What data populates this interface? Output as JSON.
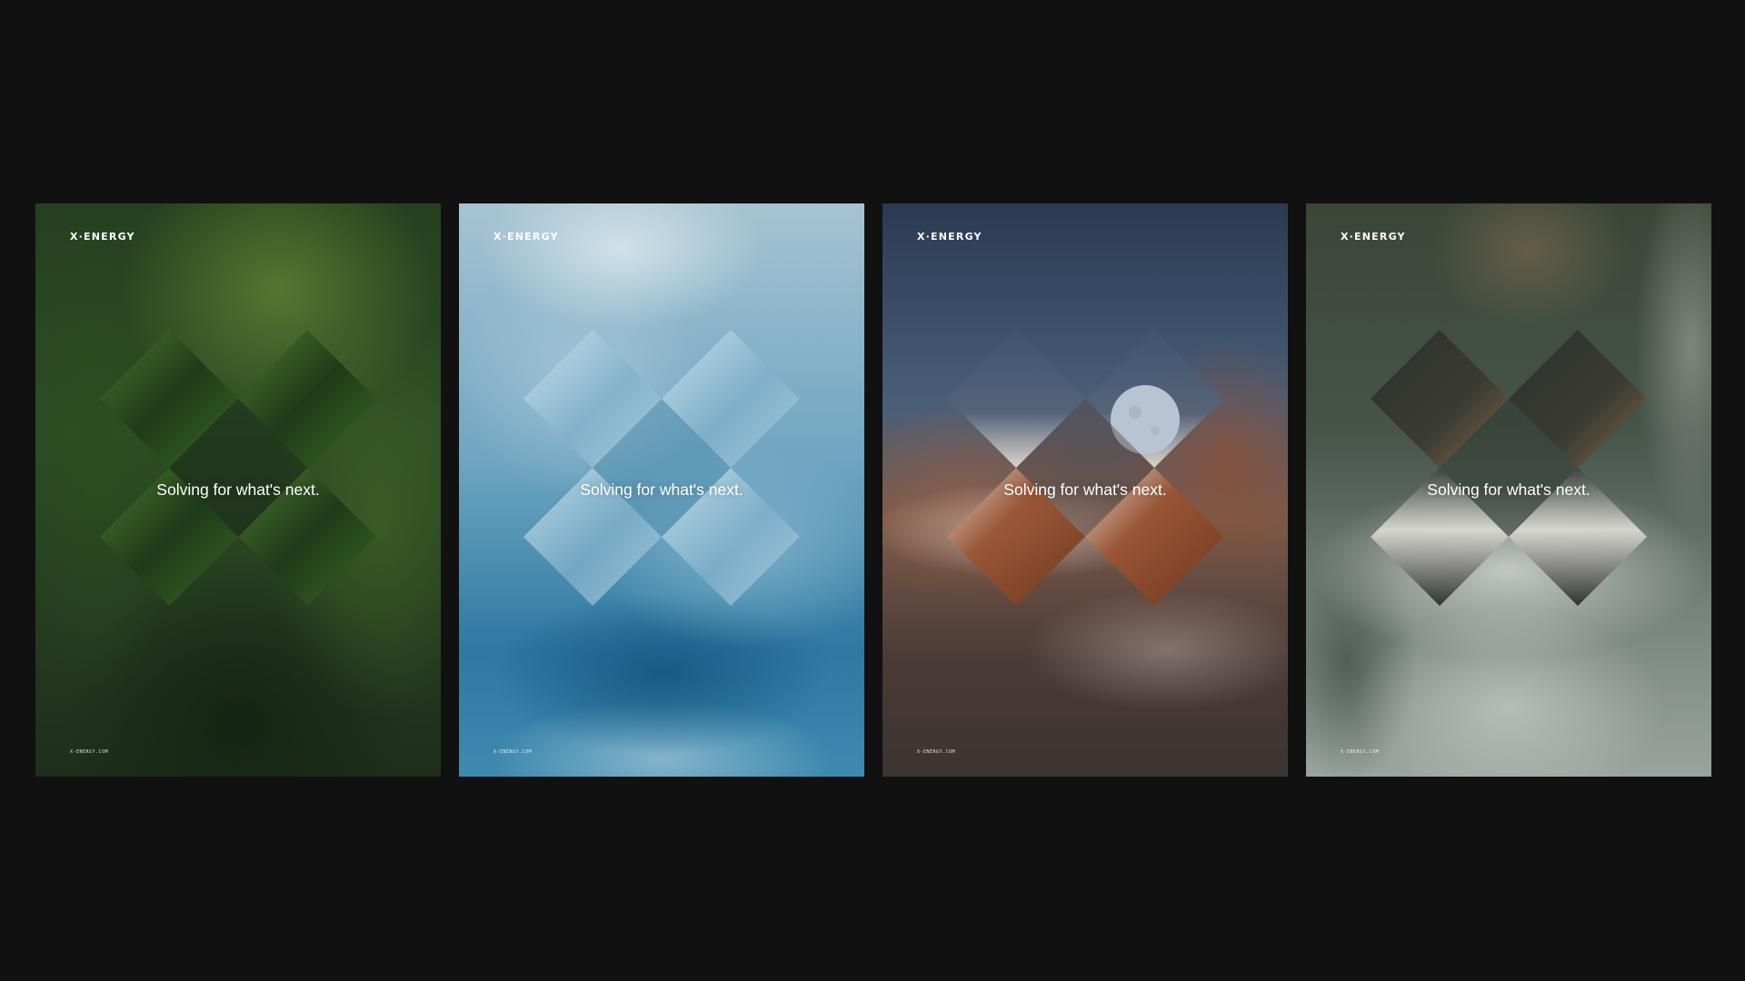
{
  "posters": [
    {
      "logo": "X·ENERGY",
      "tagline": "Solving for what's next.",
      "url": "X-ENERGY.COM",
      "theme": "forest",
      "colors": {
        "bg_top": "#1f3a1d",
        "bg_mid": "#2f5326",
        "bg_bottom": "#1b2818",
        "diamond": "#22401a",
        "diamond_highlight": "#4e7a2e"
      }
    },
    {
      "logo": "X·ENERGY",
      "tagline": "Solving for what's next.",
      "url": "X-ENERGY.COM",
      "theme": "clouds",
      "colors": {
        "bg_top": "#9fc0d2",
        "bg_mid": "#5f9ab8",
        "bg_bottom": "#1f5f85",
        "diamond": "#8fbcd3",
        "diamond_highlight": "#d8ebf3"
      }
    },
    {
      "logo": "X·ENERGY",
      "tagline": "Solving for what's next.",
      "url": "X-ENERGY.COM",
      "theme": "mountain-moon",
      "colors": {
        "bg_top": "#2d3e56",
        "bg_mid": "#6d5449",
        "bg_bottom": "#3a3330",
        "diamond": "#8a4a2c",
        "diamond_highlight": "#e8e2dc",
        "moon": "#b8c4d4"
      }
    },
    {
      "logo": "X·ENERGY",
      "tagline": "Solving for what's next.",
      "url": "X-ENERGY.COM",
      "theme": "waterfall",
      "colors": {
        "bg_top": "#3d4638",
        "bg_mid": "#47574b",
        "bg_bottom": "#a9b2ad",
        "diamond": "#2b2f2b",
        "diamond_highlight": "#dad9d3"
      }
    }
  ]
}
